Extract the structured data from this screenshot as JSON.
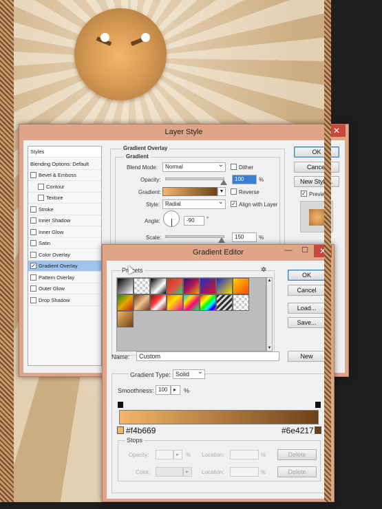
{
  "layer_style": {
    "title": "Layer Style",
    "styles_header": "Styles",
    "blending_options": "Blending Options: Default",
    "items": [
      {
        "label": "Bevel & Emboss",
        "checked": false,
        "indent": 0
      },
      {
        "label": "Contour",
        "checked": false,
        "indent": 1
      },
      {
        "label": "Texture",
        "checked": false,
        "indent": 1
      },
      {
        "label": "Stroke",
        "checked": false,
        "indent": 0
      },
      {
        "label": "Inner Shadow",
        "checked": false,
        "indent": 0
      },
      {
        "label": "Inner Glow",
        "checked": false,
        "indent": 0
      },
      {
        "label": "Satin",
        "checked": false,
        "indent": 0
      },
      {
        "label": "Color Overlay",
        "checked": false,
        "indent": 0
      },
      {
        "label": "Gradient Overlay",
        "checked": true,
        "indent": 0
      },
      {
        "label": "Pattern Overlay",
        "checked": false,
        "indent": 0
      },
      {
        "label": "Outer Glow",
        "checked": false,
        "indent": 0
      },
      {
        "label": "Drop Shadow",
        "checked": false,
        "indent": 0
      }
    ],
    "section_title": "Gradient Overlay",
    "group_title": "Gradient",
    "blend_mode_label": "Blend Mode:",
    "blend_mode_value": "Normal",
    "dither_label": "Dither",
    "opacity_label": "Opacity:",
    "opacity_value": "100",
    "percent": "%",
    "gradient_label": "Gradient:",
    "reverse_label": "Reverse",
    "style_label": "Style:",
    "style_value": "Radial",
    "align_label": "Align with Layer",
    "angle_label": "Angle:",
    "angle_value": "-90",
    "degree": "°",
    "scale_label": "Scale:",
    "scale_value": "150",
    "ok": "OK",
    "cancel": "Cancel",
    "new_style": "New Style...",
    "preview_label": "Preview",
    "close_glyph": "✕"
  },
  "gradient_editor": {
    "title": "Gradient Editor",
    "presets_label": "Presets",
    "gear_glyph": "✲",
    "ok": "OK",
    "cancel": "Cancel",
    "load": "Load...",
    "save": "Save...",
    "name_label": "Name:",
    "name_value": "Custom",
    "new_button": "New",
    "gradient_type_label": "Gradient Type:",
    "gradient_type_value": "Solid",
    "smoothness_label": "Smoothness:",
    "smoothness_value": "100",
    "smoothness_arrow": "▸",
    "percent": "%",
    "left_color": "#f4b669",
    "right_color": "#6e4217",
    "stops_label": "Stops",
    "opacity_label": "Opacity:",
    "color_label": "Color:",
    "location_label": "Location:",
    "delete": "Delete",
    "minimize_glyph": "—",
    "maximize_glyph": "☐",
    "close_glyph": "✕"
  },
  "colors": {
    "gradient_start": "#f4b669",
    "gradient_end": "#6e4217",
    "accent_selection": "#9fc5ee",
    "dialog_frame": "#dfa589"
  }
}
